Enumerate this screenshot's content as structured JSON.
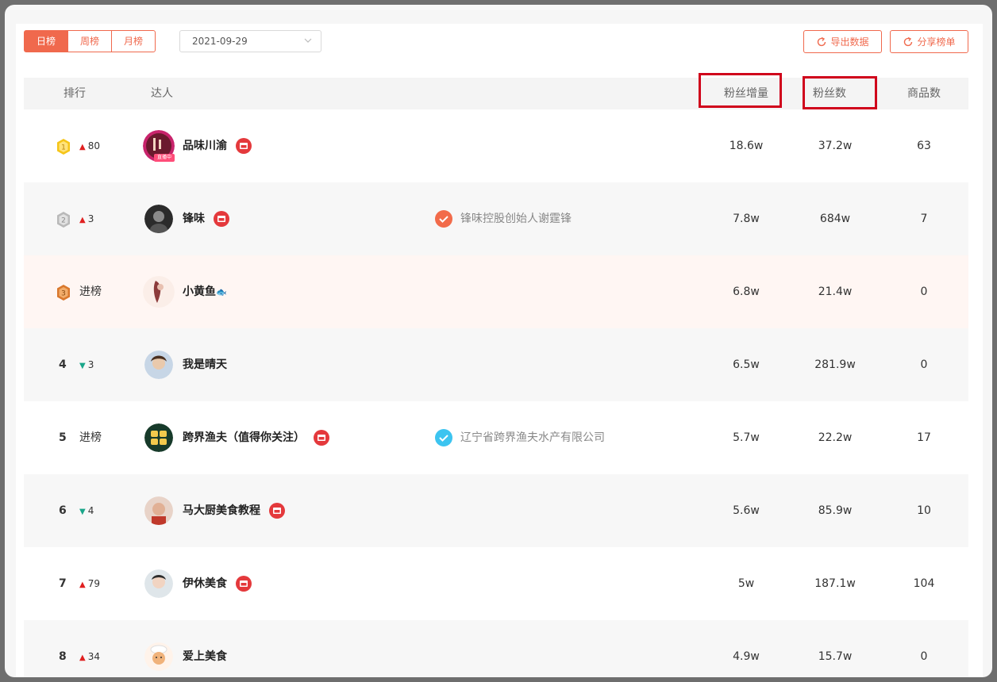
{
  "toolbar": {
    "tabs": [
      "日榜",
      "周榜",
      "月榜"
    ],
    "active_tab": 0,
    "date_value": "2021-09-29",
    "export_label": "导出数据",
    "share_label": "分享榜单"
  },
  "table": {
    "headers": {
      "rank": "排行",
      "creator": "达人",
      "fans_increase": "粉丝增量",
      "fans": "粉丝数",
      "goods": "商品数"
    },
    "rows": [
      {
        "rank": "1",
        "medal": "gold",
        "change_dir": "up",
        "change": "80",
        "name": "品味川渝",
        "shop": true,
        "live": "直播中",
        "verify": "",
        "verify_type": "",
        "fans_increase": "18.6w",
        "fans": "37.2w",
        "goods": "63"
      },
      {
        "rank": "2",
        "medal": "silver",
        "change_dir": "up",
        "change": "3",
        "name": "锋味",
        "shop": true,
        "live": "",
        "verify": "锋味控股创始人谢霆锋",
        "verify_type": "orange",
        "fans_increase": "7.8w",
        "fans": "684w",
        "goods": "7"
      },
      {
        "rank": "3",
        "medal": "bronze",
        "change_dir": "new",
        "change": "进榜",
        "name": "小黄鱼",
        "shop": false,
        "live": "",
        "verify": "",
        "verify_type": "",
        "fans_increase": "6.8w",
        "fans": "21.4w",
        "goods": "0"
      },
      {
        "rank": "4",
        "medal": "",
        "change_dir": "down",
        "change": "3",
        "name": "我是晴天",
        "shop": false,
        "live": "",
        "verify": "",
        "verify_type": "",
        "fans_increase": "6.5w",
        "fans": "281.9w",
        "goods": "0"
      },
      {
        "rank": "5",
        "medal": "",
        "change_dir": "new",
        "change": "进榜",
        "name": "跨界渔夫（值得你关注）",
        "shop": true,
        "live": "",
        "verify": "辽宁省跨界渔夫水产有限公司",
        "verify_type": "blue",
        "fans_increase": "5.7w",
        "fans": "22.2w",
        "goods": "17"
      },
      {
        "rank": "6",
        "medal": "",
        "change_dir": "down",
        "change": "4",
        "name": "马大厨美食教程",
        "shop": true,
        "live": "",
        "verify": "",
        "verify_type": "",
        "fans_increase": "5.6w",
        "fans": "85.9w",
        "goods": "10"
      },
      {
        "rank": "7",
        "medal": "",
        "change_dir": "up",
        "change": "79",
        "name": "伊休美食",
        "shop": true,
        "live": "",
        "verify": "",
        "verify_type": "",
        "fans_increase": "5w",
        "fans": "187.1w",
        "goods": "104"
      },
      {
        "rank": "8",
        "medal": "",
        "change_dir": "up",
        "change": "34",
        "name": "爱上美食",
        "shop": false,
        "live": "",
        "verify": "",
        "verify_type": "",
        "fans_increase": "4.9w",
        "fans": "15.7w",
        "goods": "0"
      }
    ]
  },
  "colors": {
    "accent": "#f0694d",
    "up": "#e02020",
    "down": "#1aa68a",
    "highlight_box": "#d0021b"
  }
}
